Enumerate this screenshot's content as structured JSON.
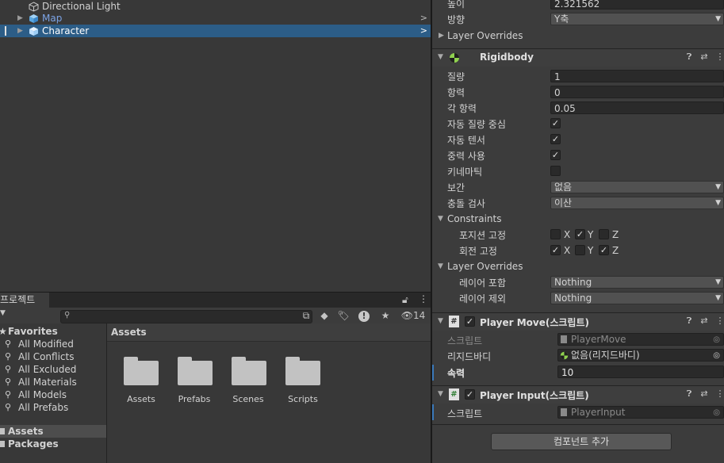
{
  "hierarchy": {
    "items": [
      {
        "label": "Directional Light"
      },
      {
        "label": "Map"
      },
      {
        "label": "Character"
      }
    ]
  },
  "project": {
    "tab": "프로젝트",
    "hidden_count": "14",
    "favorites": {
      "header": "Favorites",
      "items": [
        "All Modified",
        "All Conflicts",
        "All Excluded",
        "All Materials",
        "All Models",
        "All Prefabs"
      ]
    },
    "assets_root": "Assets",
    "packages_root": "Packages",
    "breadcrumb": "Assets",
    "folders": [
      "Assets",
      "Prefabs",
      "Scenes",
      "Scripts"
    ]
  },
  "inspector": {
    "top": {
      "height_label": "높이",
      "height_value": "2.321562",
      "direction_label": "방향",
      "direction_value": "Y축",
      "layer_overrides": "Layer Overrides"
    },
    "rigidbody": {
      "title": "Rigidbody",
      "mass_label": "질량",
      "mass_value": "1",
      "drag_label": "항력",
      "drag_value": "0",
      "angular_drag_label": "각 항력",
      "angular_drag_value": "0.05",
      "auto_com_label": "자동 질량 중심",
      "auto_tensor_label": "자동 텐서",
      "use_gravity_label": "중력 사용",
      "kinematic_label": "키네마틱",
      "interpolate_label": "보간",
      "interpolate_value": "없음",
      "collision_label": "충돌 검사",
      "collision_value": "이산",
      "constraints_label": "Constraints",
      "freeze_pos_label": "포지션 고정",
      "freeze_rot_label": "회전 고정",
      "axis_x": "X",
      "axis_y": "Y",
      "axis_z": "Z",
      "layer_overrides": "Layer Overrides",
      "include_label": "레이어 포함",
      "include_value": "Nothing",
      "exclude_label": "레이어 제외",
      "exclude_value": "Nothing"
    },
    "player_move": {
      "title": "Player Move(스크립트)",
      "script_label": "스크립트",
      "script_value": "PlayerMove",
      "rigidbody_label": "리지드바디",
      "rigidbody_value": "없음(리지드바디)",
      "speed_label": "속력",
      "speed_value": "10"
    },
    "player_input": {
      "title": "Player Input(스크립트)",
      "script_label": "스크립트",
      "script_value": "PlayerInput"
    },
    "add_component": "컴포넌트 추가"
  },
  "colors": {
    "selection": "#2c5d87",
    "accent_blue": "#3a79bb",
    "map_text": "#7ca4e6"
  }
}
